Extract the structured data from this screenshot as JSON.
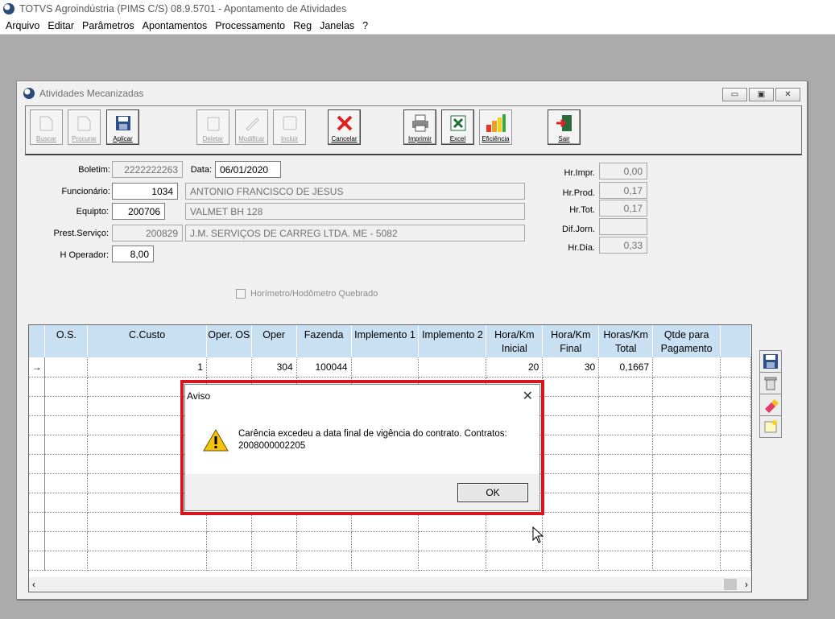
{
  "app": {
    "title": "TOTVS Agroindústria (PIMS C/S) 08.9.5701 - Apontamento de Atividades",
    "menu": [
      "Arquivo",
      "Editar",
      "Parâmetros",
      "Apontamentos",
      "Processamento",
      "Reg",
      "Janelas",
      "?"
    ]
  },
  "window": {
    "title": "Atividades Mecanizadas",
    "controls": {
      "minimize": "▭",
      "restore": "▣",
      "close": "✕"
    }
  },
  "toolbar": {
    "buscar": "Buscar",
    "procurar": "Procurar",
    "aplicar": "Aplicar",
    "deletar": "Deletar",
    "modificar": "Modificar",
    "incluir": "Incluir",
    "cancelar": "Cancelar",
    "imprimir": "Imprimir",
    "excel": "Excel",
    "eficiencia": "Eficiência",
    "sair": "Sair"
  },
  "form": {
    "boletim_label": "Boletim:",
    "boletim": "2222222263",
    "data_label": "Data:",
    "data": "06/01/2020",
    "funcionario_label": "Funcionário:",
    "funcionario_code": "1034",
    "funcionario_name": "ANTONIO FRANCISCO DE JESUS",
    "equipto_label": "Equipto:",
    "equipto_code": "200706",
    "equipto_name": "VALMET BH 128",
    "prest_label": "Prest.Serviço:",
    "prest_code": "200829",
    "prest_name": "J.M. SERVIÇOS DE CARREG LTDA.  ME - 5082",
    "hoperador_label": "H Operador:",
    "hoperador": "8,00",
    "horimetro_label": "Horímetro/Hodômetro Quebrado",
    "hr_impr_label": "Hr.Impr.",
    "hr_impr": "0,00",
    "hr_prod_label": "Hr.Prod.",
    "hr_prod": "0,17",
    "hr_tot_label": "Hr.Tot.",
    "hr_tot": "0,17",
    "dif_jorn_label": "Dif.Jorn.",
    "dif_jorn": "",
    "hr_dia_label": "Hr.Dia.",
    "hr_dia": "0,33"
  },
  "grid": {
    "headers": [
      "O.S.",
      "C.Custo",
      "Oper. OS",
      "Oper",
      "Fazenda",
      "Implemento 1",
      "Implemento 2",
      "Hora/Km Inicial",
      "Hora/Km Final",
      "Horas/Km Total",
      "Qtde para Pagamento"
    ],
    "row1": [
      "",
      "1",
      "",
      "304",
      "100044",
      "",
      "",
      "20",
      "30",
      "0,1667",
      ""
    ],
    "current_row_marker": "→",
    "scroll_left": "‹",
    "scroll_right": "›"
  },
  "dialog": {
    "title": "Aviso",
    "close": "✕",
    "message_line1": "Carência excedeu a data final de vigência do contrato. Contratos:",
    "message_line2": "2008000002205",
    "ok": "OK"
  }
}
